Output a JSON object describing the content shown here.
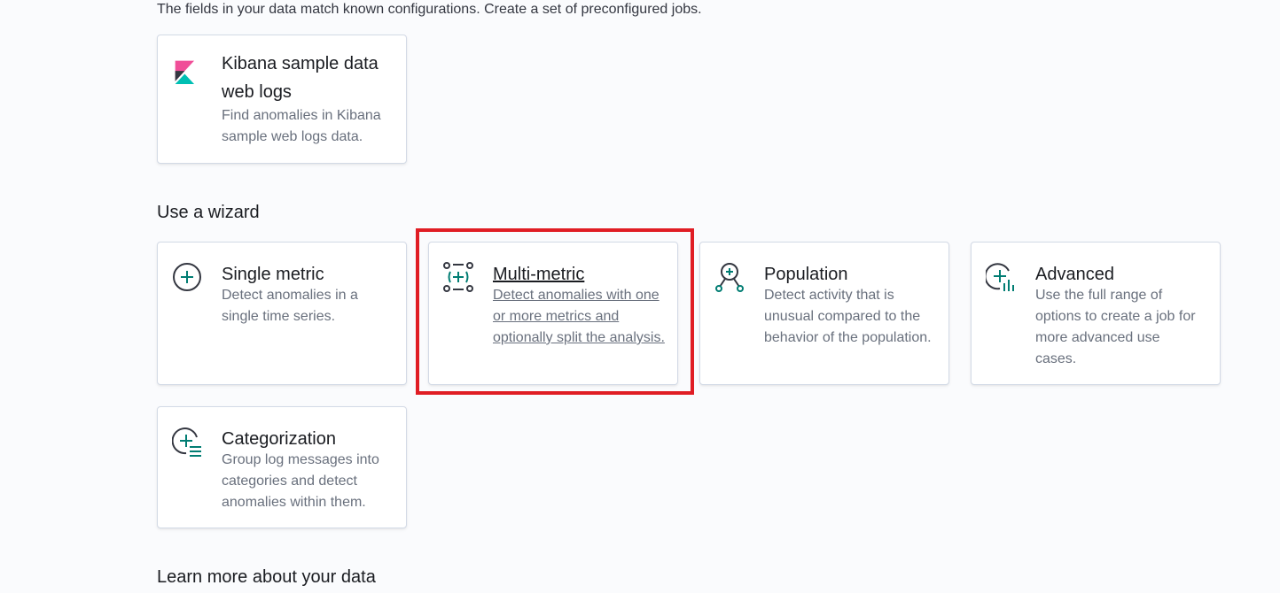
{
  "intro_text": "The fields in your data match known configurations. Create a set of preconfigured jobs.",
  "sample_card": {
    "title_line1": "Kibana sample data",
    "title_line2": "web logs",
    "desc": "Find anomalies in Kibana sample web logs data."
  },
  "wizard_title": "Use a wizard",
  "wizards": [
    {
      "title": "Single metric",
      "desc": "Detect anomalies in a single time series."
    },
    {
      "title": "Multi-metric",
      "desc": "Detect anomalies with one or more metrics and optionally split the analysis."
    },
    {
      "title": "Population",
      "desc": "Detect activity that is unusual compared to the behavior of the population."
    },
    {
      "title": "Advanced",
      "desc": "Use the full range of options to create a job for more advanced use cases."
    },
    {
      "title": "Categorization",
      "desc": "Group log messages into categories and detect anomalies within them."
    }
  ],
  "learn_title": "Learn more about your data",
  "colors": {
    "accent": "#017d73",
    "highlight": "#e01d24",
    "kibana_pink": "#f04e98",
    "kibana_teal": "#00bfb3"
  },
  "icons": [
    "kibana-logo-icon",
    "single-metric-icon",
    "multi-metric-icon",
    "population-icon",
    "advanced-icon",
    "categorization-icon"
  ]
}
